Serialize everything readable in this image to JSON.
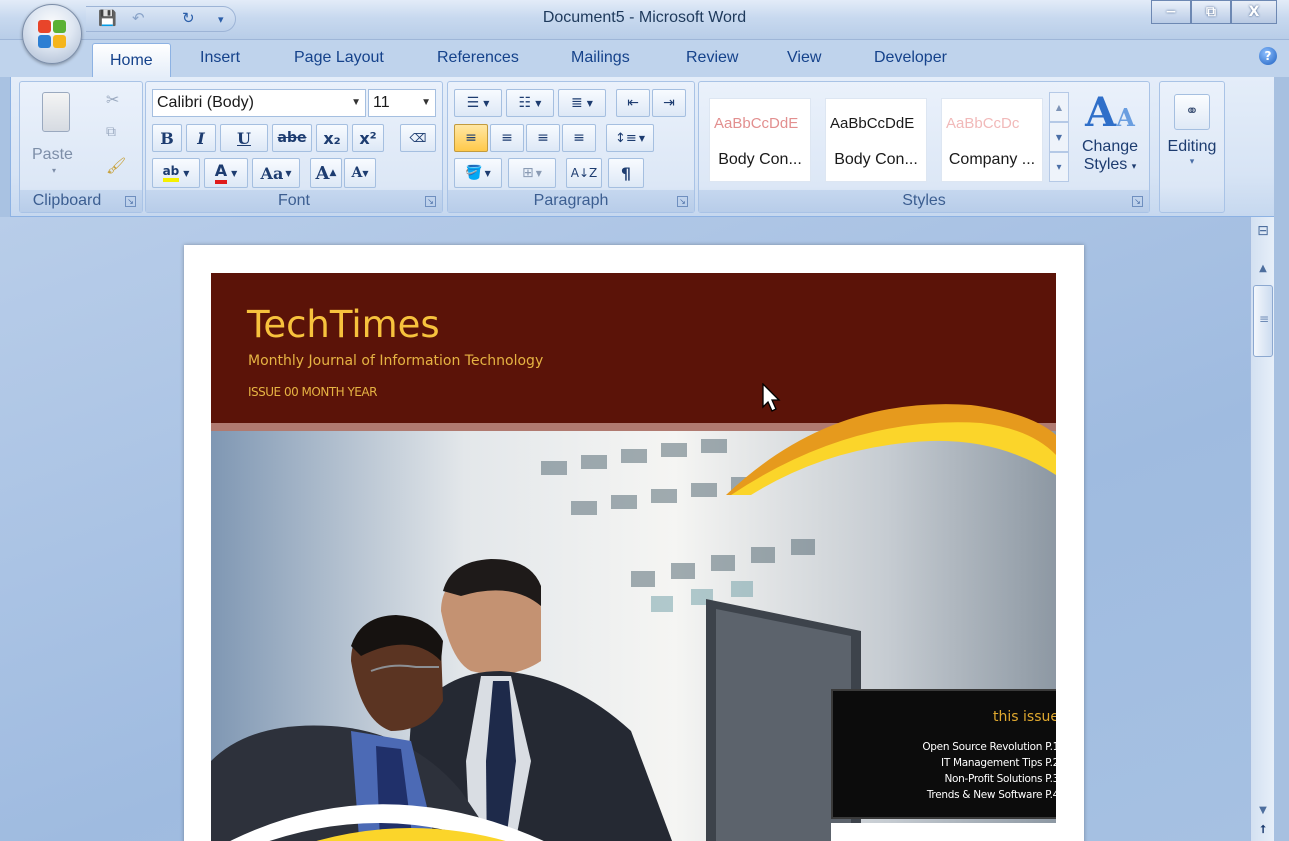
{
  "window": {
    "title": "Document5 - Microsoft Word",
    "controls": {
      "minimize": "−",
      "maximize": "⧉",
      "close": "X"
    }
  },
  "qat": {
    "save": "💾",
    "undo": "↶",
    "redo": "↻",
    "customize": "▾"
  },
  "tabs": [
    {
      "label": "Home",
      "active": true
    },
    {
      "label": "Insert"
    },
    {
      "label": "Page Layout"
    },
    {
      "label": "References"
    },
    {
      "label": "Mailings"
    },
    {
      "label": "Review"
    },
    {
      "label": "View"
    },
    {
      "label": "Developer"
    }
  ],
  "clipboard": {
    "label": "Clipboard",
    "paste": "Paste"
  },
  "font": {
    "label": "Font",
    "family": "Calibri (Body)",
    "size": "11",
    "bold": "B",
    "italic": "I",
    "underline": "U",
    "strike": "abe",
    "subscript": "x₂",
    "superscript": "x²",
    "change_case": "Aa",
    "grow": "A",
    "shrink": "A"
  },
  "paragraph": {
    "label": "Paragraph",
    "pilcrow": "¶"
  },
  "styles": {
    "label": "Styles",
    "items": [
      {
        "sample": "AaBbCcDdE",
        "name": "Body Con...",
        "color": "#e28f8f"
      },
      {
        "sample": "AaBbCcDdE",
        "name": "Body Con...",
        "color": "#1a1a1a"
      },
      {
        "sample": "AaBbCcDc",
        "name": "Company ...",
        "color": "#f1b9b9"
      }
    ],
    "change_styles": "Change\nStyles",
    "change_styles_line1": "Change",
    "change_styles_line2": "Styles"
  },
  "editing": {
    "label": "Editing"
  },
  "document": {
    "brand": "TechTimes",
    "tagline": "Monthly Journal of Information Technology",
    "issue": "ISSUE 00 MONTH YEAR",
    "this_issue": {
      "heading": "this issue",
      "items": [
        "Open Source Revolution P.1",
        "IT Management Tips  P.2",
        "Non-Profit Solutions P.3",
        "Trends & New Software P.4"
      ]
    }
  },
  "colors": {
    "banner": "#5b1308",
    "brand_gold": "#f7c23d",
    "accent_yellow": "#fbd52a",
    "accent_orange": "#e69a1d"
  }
}
